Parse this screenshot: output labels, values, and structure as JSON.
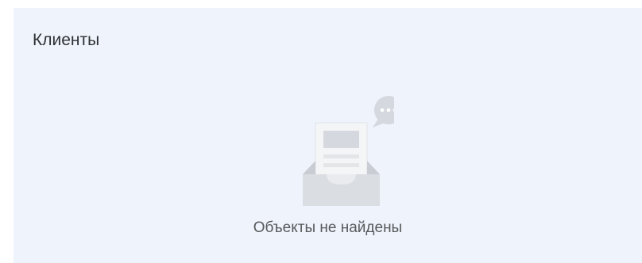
{
  "panel": {
    "title": "Клиенты",
    "empty_state": {
      "icon": "empty-inbox-icon",
      "message": "Объекты не найдены"
    }
  }
}
